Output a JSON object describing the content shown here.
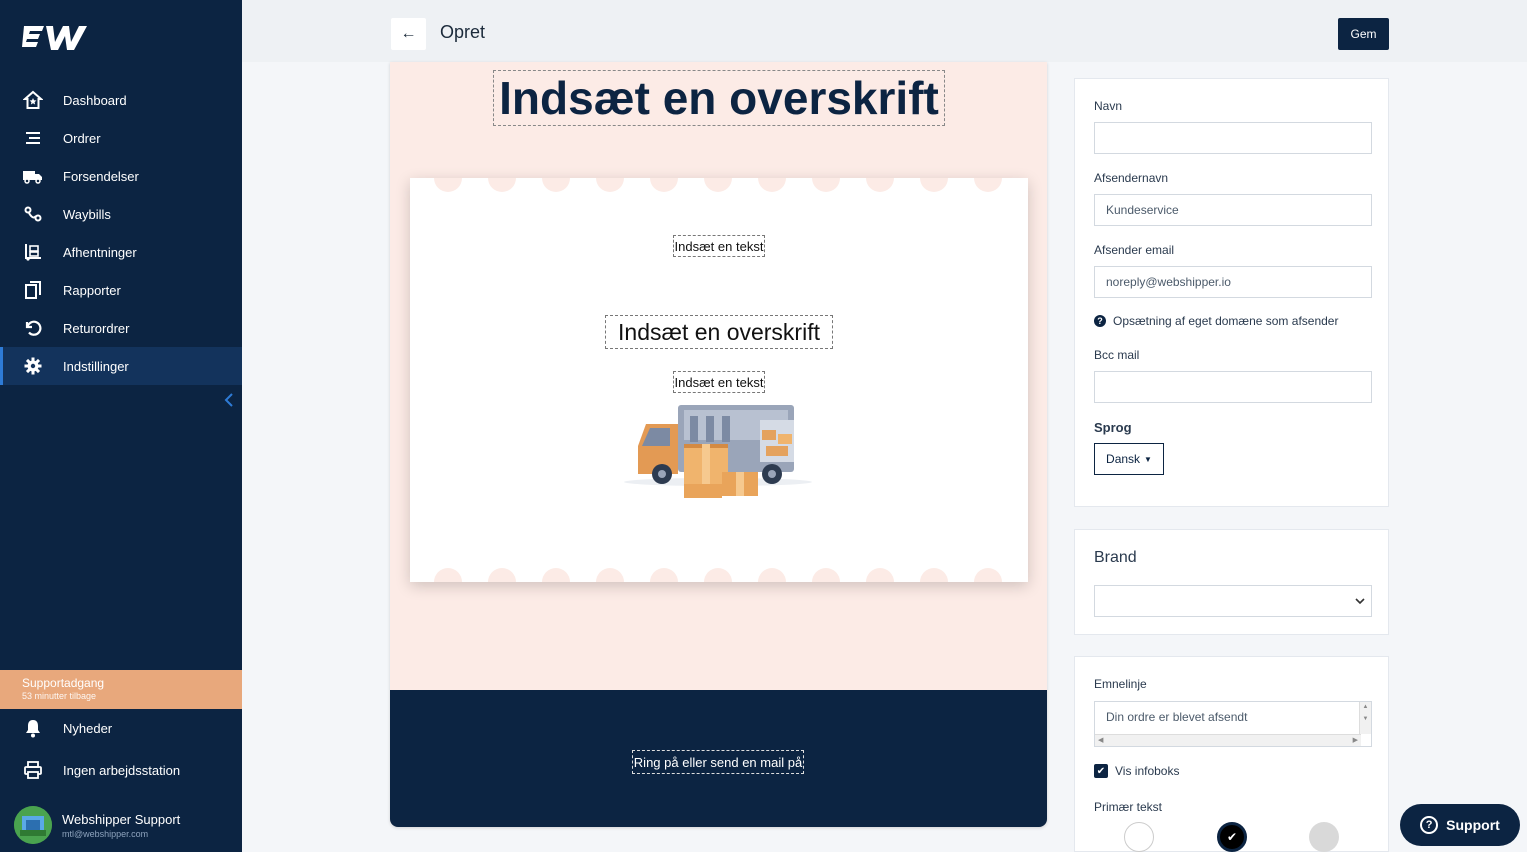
{
  "sidebar": {
    "items": [
      {
        "label": "Dashboard",
        "icon": "home-icon"
      },
      {
        "label": "Ordrer",
        "icon": "list-icon"
      },
      {
        "label": "Forsendelser",
        "icon": "truck-icon"
      },
      {
        "label": "Waybills",
        "icon": "route-icon"
      },
      {
        "label": "Afhentninger",
        "icon": "dolly-icon"
      },
      {
        "label": "Rapporter",
        "icon": "copy-icon"
      },
      {
        "label": "Returordrer",
        "icon": "undo-icon"
      },
      {
        "label": "Indstillinger",
        "icon": "gear-icon"
      }
    ],
    "active": "Indstillinger",
    "support_access": {
      "title": "Supportadgang",
      "subtitle": "53 minutter tilbage"
    },
    "news_label": "Nyheder",
    "workstation_label": "Ingen arbejdsstation",
    "user": {
      "name": "Webshipper Support",
      "email": "mtl@webshipper.com"
    }
  },
  "topbar": {
    "back_label": "←",
    "title": "Opret",
    "save_label": "Gem"
  },
  "preview": {
    "main_heading": "Indsæt en overskrift",
    "text_1": "Indsæt en tekst",
    "heading_2": "Indsæt en overskrift",
    "text_2": "Indsæt en tekst",
    "footer_text": "Ring på eller send en mail på"
  },
  "form": {
    "name_label": "Navn",
    "name_value": "",
    "sender_name_label": "Afsendernavn",
    "sender_name_value": "Kundeservice",
    "sender_email_label": "Afsender email",
    "sender_email_value": "noreply@webshipper.io",
    "domain_help": "Opsætning af eget domæne som afsender",
    "bcc_label": "Bcc mail",
    "bcc_value": "",
    "language_label": "Sprog",
    "language_value": "Dansk",
    "brand_title": "Brand",
    "brand_value": "",
    "subject_label": "Emnelinje",
    "subject_value": "Din ordre er blevet afsendt",
    "infobox_label": "Vis infoboks",
    "infobox_checked": true,
    "primary_text_label": "Primær tekst",
    "primary_text_colors": [
      "#ffffff",
      "#000000",
      "#d9d9d9"
    ]
  },
  "support_button": {
    "label": "Support"
  },
  "colors": {
    "navy": "#0c2442",
    "peach": "#fcebe6",
    "accent": "#e8a87c"
  }
}
